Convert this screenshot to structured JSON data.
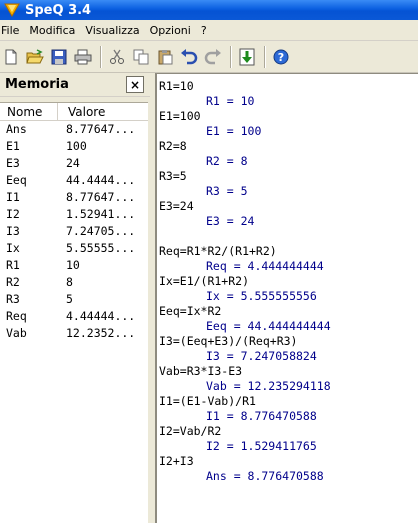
{
  "window": {
    "title": "SpeQ 3.4"
  },
  "menu": [
    "File",
    "Modifica",
    "Visualizza",
    "Opzioni",
    "?"
  ],
  "toolbar": {
    "buttons": [
      "new-file-icon",
      "open-folder-icon",
      "save-icon",
      "print-icon",
      "cut-icon",
      "copy-icon",
      "paste-icon",
      "undo-icon",
      "redo-icon",
      "download-icon",
      "help-icon"
    ]
  },
  "panel": {
    "title": "Memoria",
    "close_label": "×",
    "columns": {
      "name": "Nome",
      "value": "Valore"
    },
    "rows": [
      {
        "name": "Ans",
        "value": "8.77647..."
      },
      {
        "name": "E1",
        "value": "100"
      },
      {
        "name": "E3",
        "value": "24"
      },
      {
        "name": "Eeq",
        "value": "44.4444..."
      },
      {
        "name": "I1",
        "value": "8.77647..."
      },
      {
        "name": "I2",
        "value": "1.52941..."
      },
      {
        "name": "I3",
        "value": "7.24705..."
      },
      {
        "name": "Ix",
        "value": "5.55555..."
      },
      {
        "name": "R1",
        "value": "10"
      },
      {
        "name": "R2",
        "value": "8"
      },
      {
        "name": "R3",
        "value": "5"
      },
      {
        "name": "Req",
        "value": "4.44444..."
      },
      {
        "name": "Vab",
        "value": "12.2352..."
      }
    ]
  },
  "editor": {
    "lines": [
      {
        "type": "input",
        "text": "R1=10"
      },
      {
        "type": "result",
        "text": "R1 = 10"
      },
      {
        "type": "input",
        "text": "E1=100"
      },
      {
        "type": "result",
        "text": "E1 = 100"
      },
      {
        "type": "input",
        "text": "R2=8"
      },
      {
        "type": "result",
        "text": "R2 = 8"
      },
      {
        "type": "input",
        "text": "R3=5"
      },
      {
        "type": "result",
        "text": "R3 = 5"
      },
      {
        "type": "input",
        "text": "E3=24"
      },
      {
        "type": "result",
        "text": "E3 = 24"
      },
      {
        "type": "blank",
        "text": ""
      },
      {
        "type": "input",
        "text": "Req=R1*R2/(R1+R2)"
      },
      {
        "type": "result",
        "text": "Req = 4.444444444"
      },
      {
        "type": "input",
        "text": "Ix=E1/(R1+R2)"
      },
      {
        "type": "result",
        "text": "Ix = 5.555555556"
      },
      {
        "type": "input",
        "text": "Eeq=Ix*R2"
      },
      {
        "type": "result",
        "text": "Eeq = 44.444444444"
      },
      {
        "type": "input",
        "text": "I3=(Eeq+E3)/(Req+R3)"
      },
      {
        "type": "result",
        "text": "I3 = 7.247058824"
      },
      {
        "type": "input",
        "text": "Vab=R3*I3-E3"
      },
      {
        "type": "result",
        "text": "Vab = 12.235294118"
      },
      {
        "type": "input",
        "text": "I1=(E1-Vab)/R1"
      },
      {
        "type": "result",
        "text": "I1 = 8.776470588"
      },
      {
        "type": "input",
        "text": "I2=Vab/R2"
      },
      {
        "type": "result",
        "text": "I2 = 1.529411765"
      },
      {
        "type": "input",
        "text": "I2+I3"
      },
      {
        "type": "result",
        "text": "Ans = 8.776470588"
      }
    ]
  },
  "colors": {
    "titlebar": "#0553d4",
    "result_text": "#00008b",
    "chrome": "#ece9d8"
  }
}
